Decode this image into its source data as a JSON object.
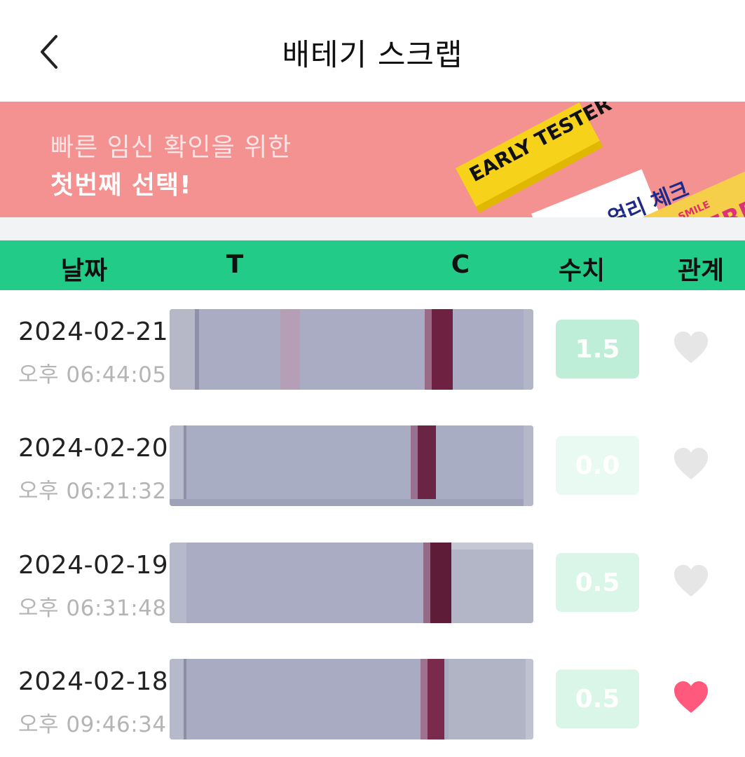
{
  "header": {
    "title": "배테기 스크랩",
    "back_icon": "chevron-left-icon"
  },
  "banner": {
    "line1": "빠른 임신 확인을 위한",
    "line2": "첫번째 선택!",
    "products": [
      "EARLY TESTER",
      "얼리 체크",
      "SMILE",
      "SUPERFA"
    ]
  },
  "table": {
    "headers": {
      "date": "날짜",
      "t": "T",
      "c": "C",
      "value": "수치",
      "relation": "관계"
    },
    "rows": [
      {
        "date": "2024-02-21",
        "time": "오후 06:44:05",
        "value": "1.5",
        "liked": false,
        "badge_color": "#bfeed8"
      },
      {
        "date": "2024-02-20",
        "time": "오후 06:21:32",
        "value": "0.0",
        "liked": false,
        "badge_color": "#e9faf2"
      },
      {
        "date": "2024-02-19",
        "time": "오후 06:31:48",
        "value": "0.5",
        "liked": false,
        "badge_color": "#daf6e8"
      },
      {
        "date": "2024-02-18",
        "time": "오후 09:46:34",
        "value": "0.5",
        "liked": true,
        "badge_color": "#daf6e8"
      }
    ]
  },
  "colors": {
    "accent": "#22cc88",
    "banner": "#f49191",
    "heart_on": "#ff5a7d",
    "heart_off": "#e6e6e6"
  }
}
